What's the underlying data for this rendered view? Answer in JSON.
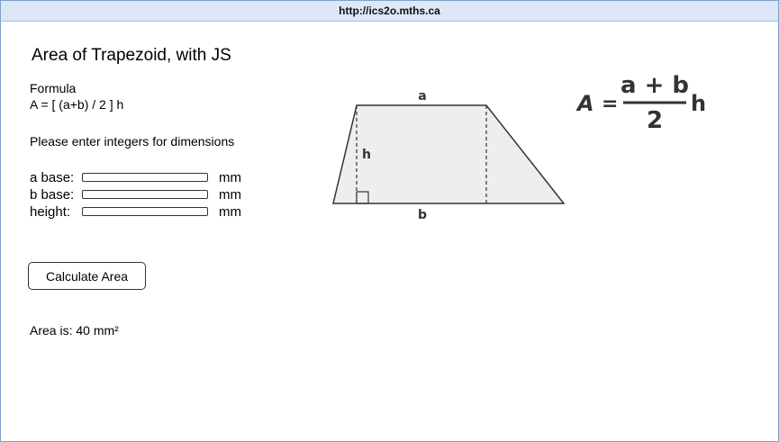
{
  "browser": {
    "url": "http://ics2o.mths.ca"
  },
  "page": {
    "title": "Area of Trapezoid, with JS",
    "formula_label": "Formula",
    "formula_text": "A = [ (a+b) / 2 ] h",
    "instructions": "Please enter integers for dimensions"
  },
  "form": {
    "a_base": {
      "label": "a base:",
      "unit": "mm",
      "value": ""
    },
    "b_base": {
      "label": "b base:",
      "unit": "mm",
      "value": ""
    },
    "height": {
      "label": "height:",
      "unit": "mm",
      "value": ""
    },
    "calculate_label": "Calculate Area"
  },
  "result": {
    "text": "Area is: 40 mm²"
  },
  "diagram": {
    "label_a": "a",
    "label_b": "b",
    "label_h": "h"
  },
  "formula_graphic": {
    "lhs": "A",
    "equals": "=",
    "numerator": "a + b",
    "denominator": "2",
    "multiplier": "h"
  },
  "colors": {
    "titlebar_bg": "#dce8f8",
    "window_border": "#7fa0c8",
    "trapezoid_fill": "#eeeeee",
    "formula_text": "#333333"
  }
}
